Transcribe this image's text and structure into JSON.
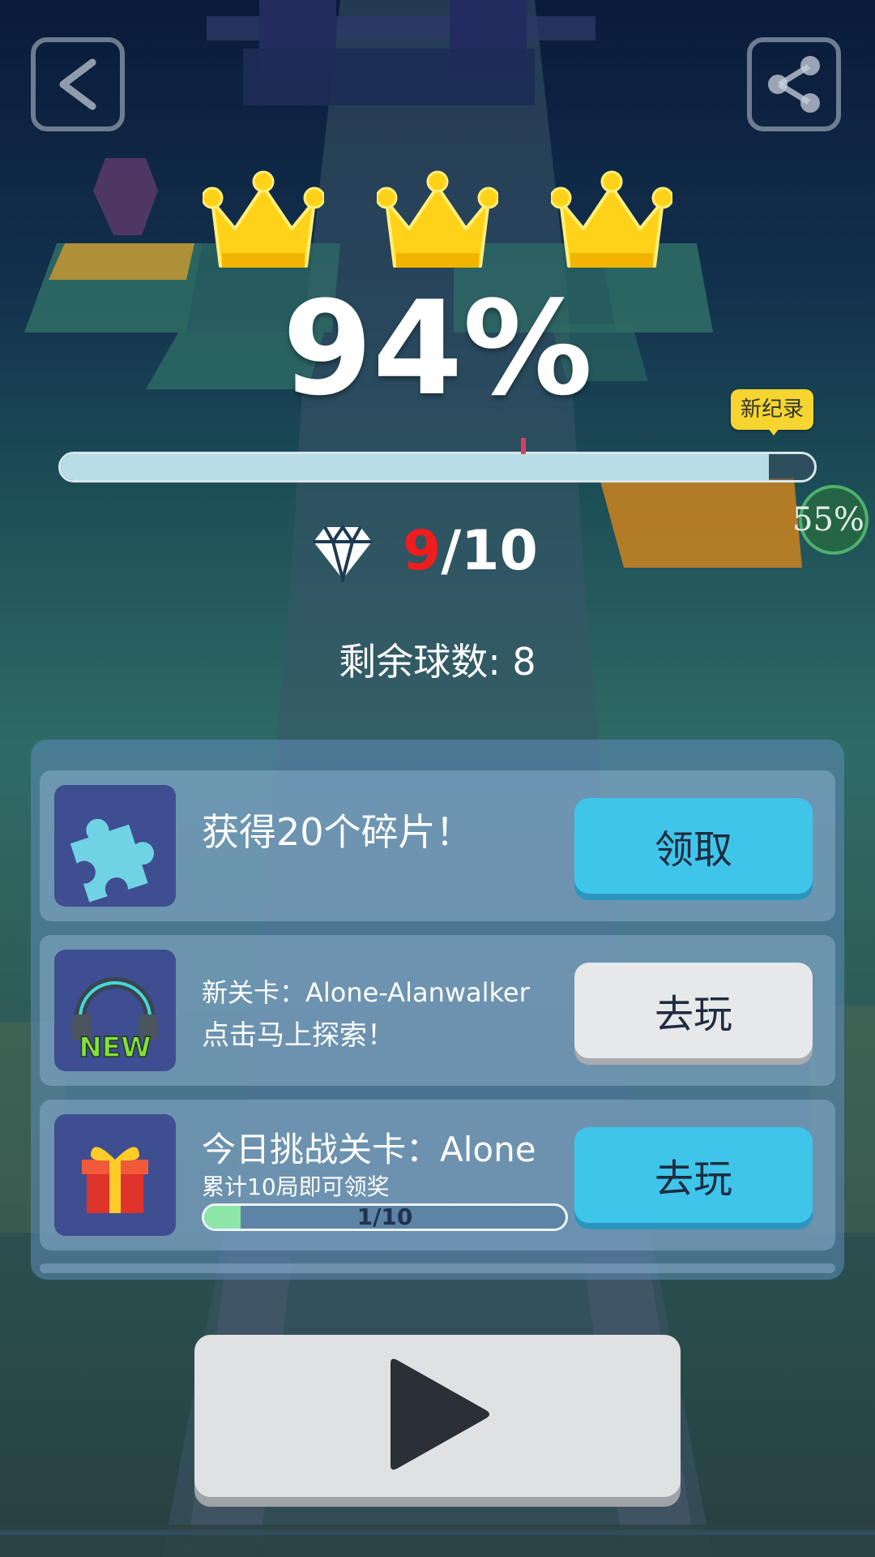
{
  "game": {
    "result_percent": "94%",
    "progress_fraction": 0.94,
    "crowns_earned": 3,
    "record_badge": "新纪录",
    "best_percent": "55%",
    "gems_collected": "9",
    "gems_total": "/10",
    "balls_remaining": "剩余球数: 8"
  },
  "tasks": [
    {
      "title": "获得20个碎片！",
      "button": "领取",
      "icon": "puzzle-piece-icon"
    },
    {
      "title": "新关卡：Alone-Alanwalker",
      "subtitle": "点击马上探索！",
      "button": "去玩",
      "icon": "new-headphones-icon",
      "badge": "NEW"
    },
    {
      "title": "今日挑战关卡：Alone",
      "subtitle": "累计10局即可领奖",
      "progress_text": "1/10",
      "progress_fraction": 0.1,
      "button": "去玩",
      "icon": "gift-icon"
    }
  ],
  "icons": {
    "back": "back-arrow-icon",
    "share": "share-icon",
    "crown": "crown-icon",
    "gem": "diamond-icon",
    "play": "play-icon"
  },
  "colors": {
    "crown": "#ffd21a",
    "accent_blue": "#3fc5ea",
    "gem_count_red": "#ef1d1d",
    "record_badge": "#f7d531"
  }
}
